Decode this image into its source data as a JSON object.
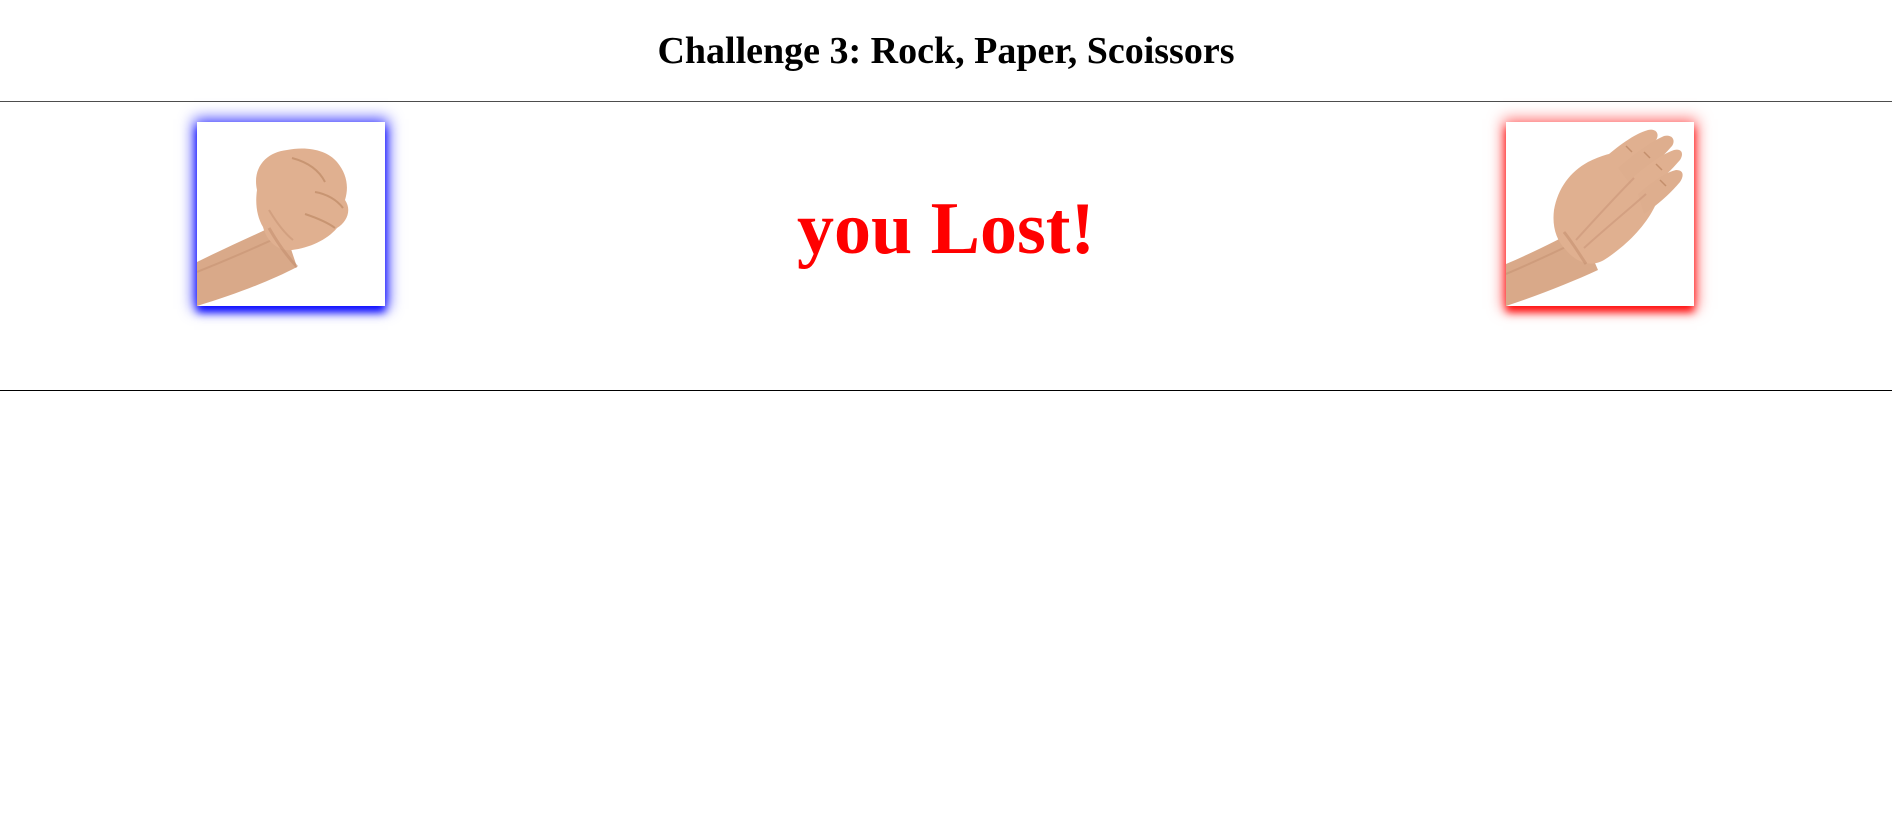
{
  "header": {
    "title": "Challenge 3: Rock, Paper, Scoissors"
  },
  "game": {
    "player_choice": "rock",
    "bot_choice": "paper",
    "result": "you Lost!",
    "colors": {
      "player": "#0000ff",
      "bot": "#ff0000",
      "result": "#ff0000"
    }
  }
}
